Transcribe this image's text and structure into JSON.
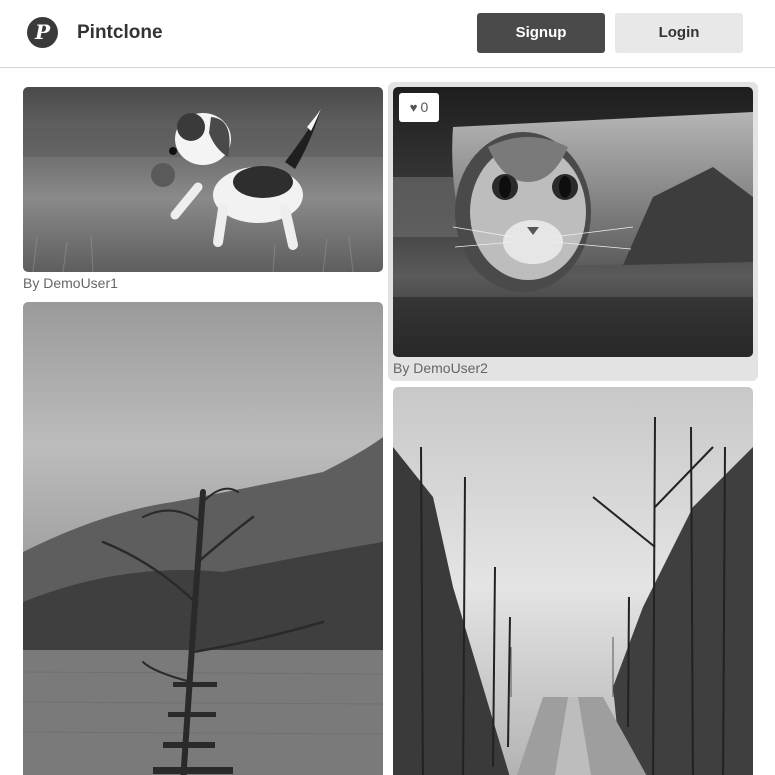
{
  "header": {
    "logo_letter": "P",
    "brand": "Pintclone",
    "signup_label": "Signup",
    "login_label": "Login"
  },
  "pins": [
    {
      "author": "By DemoUser1",
      "image": "beagle-puppy-photo"
    },
    {
      "author": "By DemoUser2",
      "image": "cat-in-paper-roll-photo",
      "likes": "0"
    },
    {
      "author": "",
      "image": "lake-tree-mountain-photo"
    },
    {
      "author": "",
      "image": "forest-road-photo"
    }
  ]
}
